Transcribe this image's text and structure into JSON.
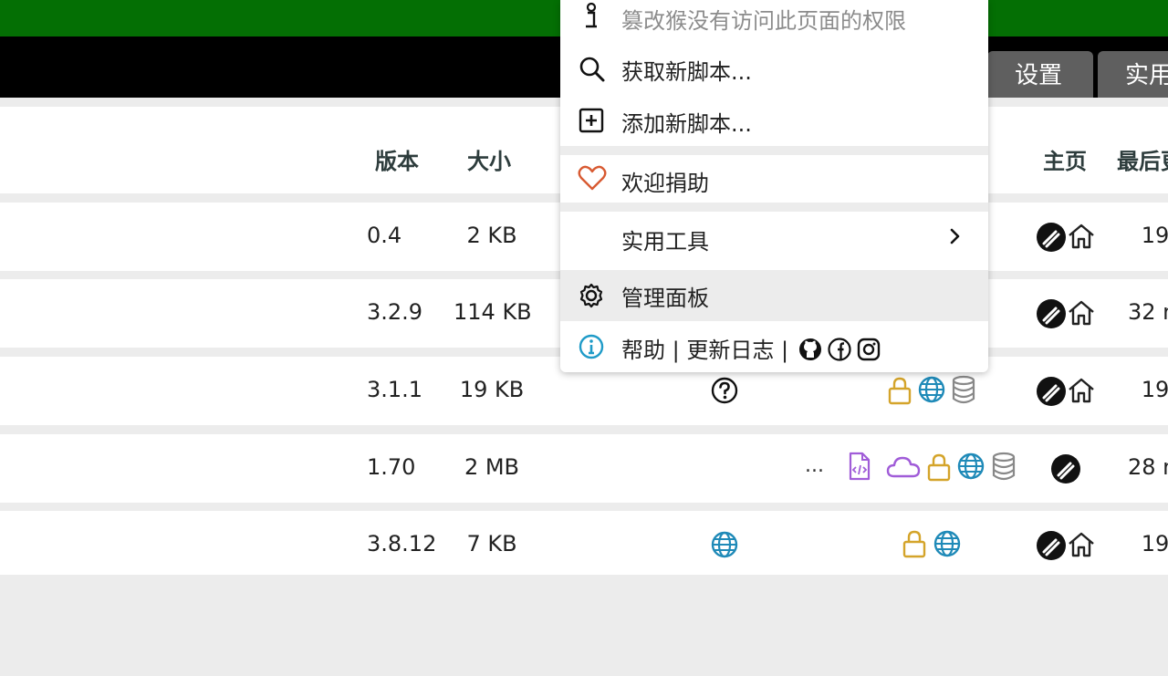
{
  "tabs": [
    {
      "label": "设置"
    },
    {
      "label": "实用"
    }
  ],
  "table": {
    "headers": {
      "version": "版本",
      "size": "大小",
      "homepage": "主页",
      "updated": "最后更"
    },
    "rows": [
      {
        "version": "0.4",
        "size": "2 KB",
        "updated": "19"
      },
      {
        "version": "3.2.9",
        "size": "114 KB",
        "updated": "32 m"
      },
      {
        "version": "3.1.1",
        "size": "19 KB",
        "updated": "19"
      },
      {
        "version": "1.70",
        "size": "2 MB",
        "updated": "28 m",
        "ellipsis": "..."
      },
      {
        "version": "3.8.12",
        "size": "7 KB",
        "updated": "19"
      }
    ]
  },
  "menu": {
    "no_access": "篡改猴没有访问此页面的权限",
    "get_new": "获取新脚本...",
    "add_new": "添加新脚本...",
    "donate": "欢迎捐助",
    "utilities": "实用工具",
    "dashboard": "管理面板",
    "help_changelog": "帮助 | 更新日志 |"
  },
  "colors": {
    "topbar": "#046f04",
    "tabbar": "#000000",
    "tab": "#5f5f5f",
    "lock": "#d4a42a",
    "globe": "#1f8ab8",
    "cloud": "#a05cd8",
    "heart": "#d85a32",
    "info": "#1f9bc8"
  }
}
